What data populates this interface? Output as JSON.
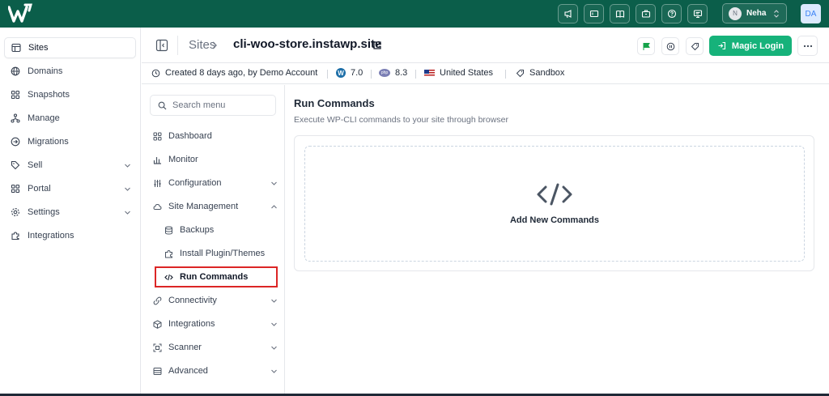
{
  "topbar": {
    "icons": [
      "megaphone-icon",
      "ticket-icon",
      "book-icon",
      "briefcase-icon",
      "help-icon",
      "monitor-icon"
    ],
    "user": {
      "initial": "N",
      "name": "Neha"
    },
    "account_badge": "DA",
    "bg_color": "#0b5e4a"
  },
  "sidebar": {
    "items": [
      {
        "label": "Sites",
        "icon": "table-icon",
        "active": true,
        "has_chevron": false
      },
      {
        "label": "Domains",
        "icon": "globe-icon",
        "active": false,
        "has_chevron": false
      },
      {
        "label": "Snapshots",
        "icon": "grid-icon",
        "active": false,
        "has_chevron": false
      },
      {
        "label": "Manage",
        "icon": "network-icon",
        "active": false,
        "has_chevron": false
      },
      {
        "label": "Migrations",
        "icon": "arrow-circle-icon",
        "active": false,
        "has_chevron": false
      },
      {
        "label": "Sell",
        "icon": "tag-icon",
        "active": false,
        "has_chevron": true
      },
      {
        "label": "Portal",
        "icon": "grid-icon",
        "active": false,
        "has_chevron": true
      },
      {
        "label": "Settings",
        "icon": "gear-icon",
        "active": false,
        "has_chevron": true
      },
      {
        "label": "Integrations",
        "icon": "puzzle-icon",
        "active": false,
        "has_chevron": false
      }
    ]
  },
  "header": {
    "breadcrumb_root": "Sites",
    "site_name": "cli-woo-store.instawp.site",
    "magic_login_label": "Magic Login",
    "accent_color": "#16b27a"
  },
  "info": {
    "created": "Created 8 days ago, by Demo Account",
    "wp_version": "7.0",
    "php_version": "8.3",
    "region": "United States",
    "plan": "Sandbox"
  },
  "submenu": {
    "search_placeholder": "Search menu",
    "items": [
      {
        "label": "Dashboard",
        "icon": "grid-icon",
        "level": 0,
        "chevron": ""
      },
      {
        "label": "Monitor",
        "icon": "bar-chart-icon",
        "level": 0,
        "chevron": ""
      },
      {
        "label": "Configuration",
        "icon": "sliders-icon",
        "level": 0,
        "chevron": "down"
      },
      {
        "label": "Site Management",
        "icon": "cloud-icon",
        "level": 0,
        "chevron": "up"
      },
      {
        "label": "Backups",
        "icon": "database-icon",
        "level": 1,
        "chevron": ""
      },
      {
        "label": "Install Plugin/Themes",
        "icon": "puzzle-icon",
        "level": 1,
        "chevron": ""
      },
      {
        "label": "Run Commands",
        "icon": "code-icon",
        "level": 1,
        "chevron": "",
        "selected": true
      },
      {
        "label": "Connectivity",
        "icon": "link-icon",
        "level": 0,
        "chevron": "down"
      },
      {
        "label": "Integrations",
        "icon": "box-icon",
        "level": 0,
        "chevron": "down"
      },
      {
        "label": "Scanner",
        "icon": "scan-icon",
        "level": 0,
        "chevron": "down"
      },
      {
        "label": "Advanced",
        "icon": "panel-icon",
        "level": 0,
        "chevron": "down"
      }
    ]
  },
  "main": {
    "title": "Run Commands",
    "description": "Execute WP-CLI commands to your site through browser",
    "empty_label": "Add New Commands"
  }
}
